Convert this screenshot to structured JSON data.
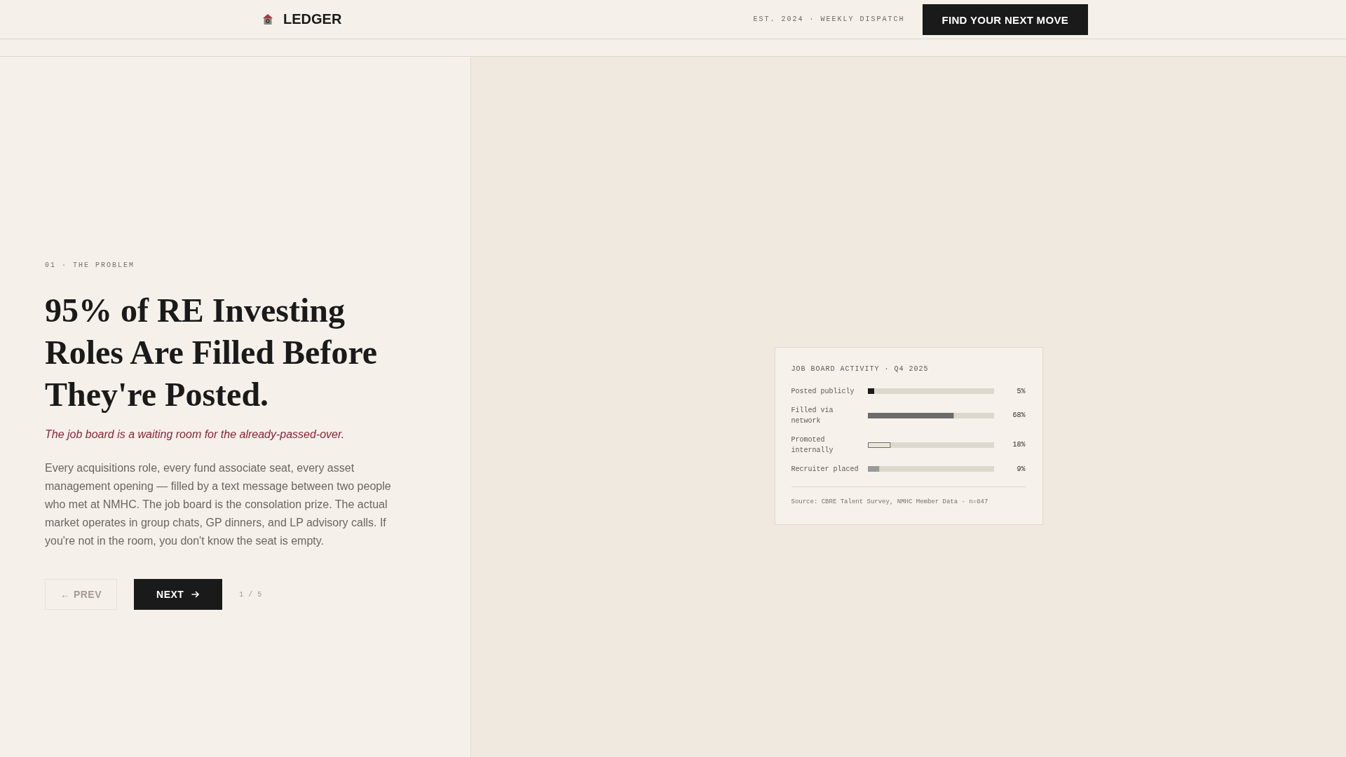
{
  "header": {
    "logo": "LEDGER",
    "tagline": "EST. 2024 · WEEKLY DISPATCH",
    "cta": "FIND YOUR NEXT MOVE"
  },
  "slide": {
    "eyebrow": "01 · THE PROBLEM",
    "title": "95% of RE Investing Roles Are Filled Before They're Posted.",
    "lede": "The job board is a waiting room for the already-passed-over.",
    "body": "Every acquisitions role, every fund associate seat, every asset management opening — filled by a text message between two people who met at NMHC. The job board is the consolation prize. The actual market operates in group chats, GP dinners, and LP advisory calls. If you're not in the room, you don't know the seat is empty.",
    "buttons": [
      {
        "kind": "prev",
        "label": "← PREV",
        "disabled": true
      },
      {
        "kind": "next",
        "label": "NEXT",
        "disabled": false
      }
    ],
    "counter": "1 / 5"
  },
  "card": {
    "chart_data": [
      {
        "type": "bar",
        "orientation": "horizontal",
        "title": "JOB BOARD ACTIVITY · Q4 2025",
        "categories": [
          "Posted publicly",
          "Filled via network",
          "Promoted internally",
          "Recruiter placed"
        ],
        "values": [
          5,
          68,
          18,
          9
        ],
        "colors": [
          "#1a1a1a",
          "#6b6b6b",
          "#ece6da",
          "#9a9a9a"
        ],
        "value_labels": [
          "5%",
          "68%",
          "18%",
          "9%"
        ],
        "xlim": [
          0,
          100
        ]
      }
    ],
    "source": "Source: CBRE Talent Survey, NMHC Member Data · n=847"
  }
}
